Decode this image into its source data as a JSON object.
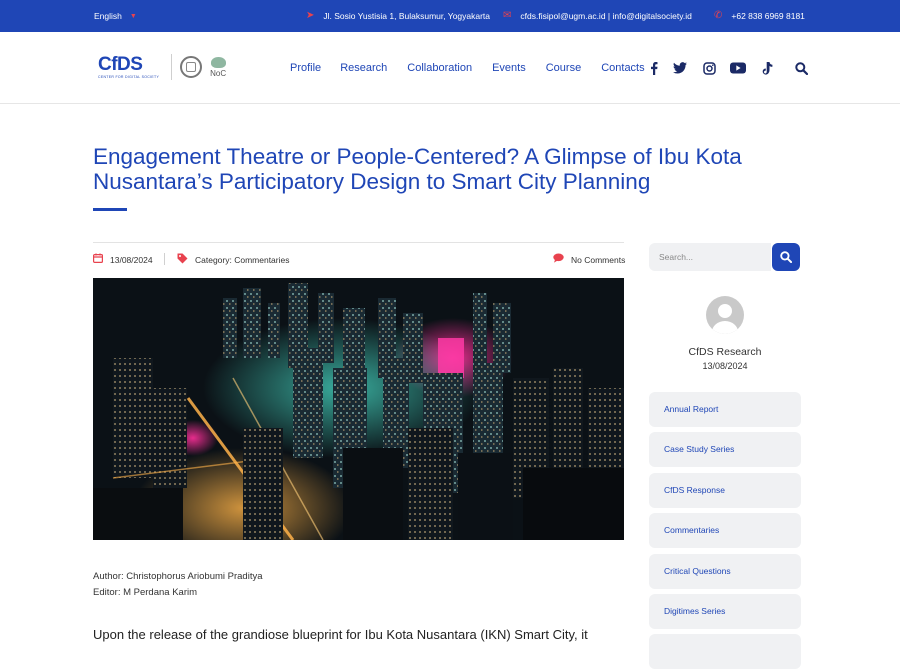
{
  "topbar": {
    "language": "English",
    "address": "Jl. Sosio Yustisia 1, Bulaksumur, Yogyakarta",
    "email": "cfds.fisipol@ugm.ac.id | info@digitalsociety.id",
    "phone": "+62 838 6969 8181"
  },
  "logo": {
    "cfds": "CfDS",
    "subtitle": "CENTER FOR DIGITAL SOCIETY",
    "noc": "NoC"
  },
  "nav": [
    "Profile",
    "Research",
    "Collaboration",
    "Events",
    "Course",
    "Contacts"
  ],
  "social_icons": [
    "facebook-icon",
    "twitter-icon",
    "instagram-icon",
    "youtube-icon",
    "tiktok-icon",
    "search-icon"
  ],
  "post": {
    "title": "Engagement Theatre or People-Centered? A Glimpse of Ibu Kota Nusantara’s Participatory Design to Smart City Planning",
    "date": "13/08/2024",
    "category": "Category: Commentaries",
    "comments": "No Comments",
    "author": "Author: Christophorus Ariobumi Praditya",
    "editor": "Editor: M Perdana Karim",
    "body_start": "Upon the release of the grandiose blueprint for Ibu Kota Nusantara (IKN) Smart City, it"
  },
  "sidebar": {
    "search_placeholder": "Search...",
    "author_name": "CfDS Research",
    "author_date": "13/08/2024",
    "categories": [
      "Annual Report",
      "Case Study Series",
      "CfDS Response",
      "Commentaries",
      "Critical Questions",
      "Digitimes Series"
    ]
  },
  "colors": {
    "primary": "#1f46b6",
    "accent": "#e8424e"
  }
}
